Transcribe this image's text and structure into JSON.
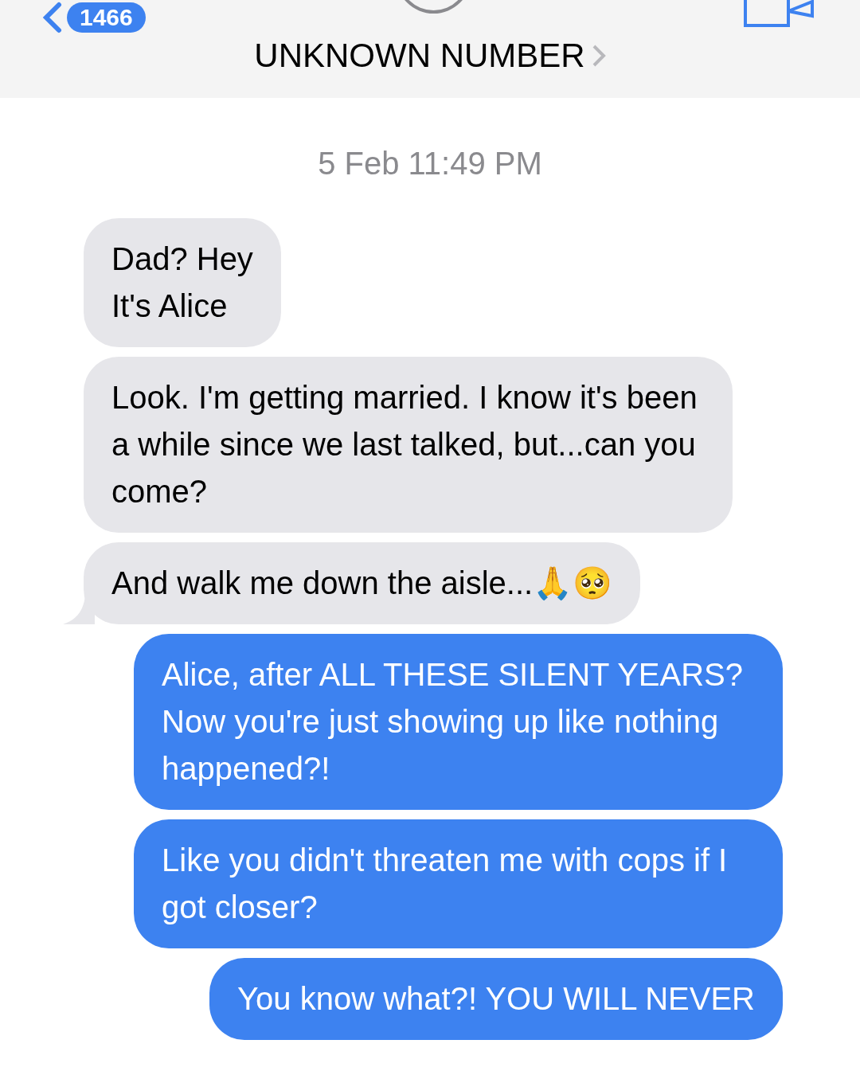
{
  "header": {
    "back_badge": "1466",
    "contact": "UNKNOWN NUMBER"
  },
  "timestamp": "5 Feb 11:49 PM",
  "messages": [
    {
      "kind": "received",
      "text": "Dad? Hey\nIt's Alice",
      "tail": false
    },
    {
      "kind": "received",
      "text": "Look. I'm getting married. I know it's been a while since we last talked, but...can you come?",
      "tail": false
    },
    {
      "kind": "received",
      "text": "And walk me down the aisle...🙏🥺",
      "tail": true
    },
    {
      "kind": "sent",
      "text": "Alice, after ALL THESE SILENT YEARS? Now you're just showing up like nothing happened?!",
      "tail": false
    },
    {
      "kind": "sent",
      "text": "Like you didn't threaten me with cops if I got closer?",
      "tail": false
    },
    {
      "kind": "sent",
      "text": "You know what?! YOU WILL NEVER",
      "tail": false
    }
  ]
}
